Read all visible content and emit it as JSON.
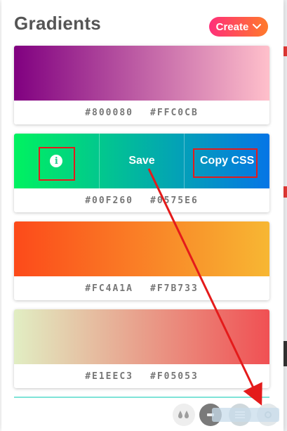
{
  "header": {
    "title": "Gradients",
    "create_label": "Create",
    "create_colors": [
      "#ff2f7a",
      "#ff7a2a"
    ]
  },
  "gradients": [
    {
      "from": "#800080",
      "to": "#FFC0CB"
    },
    {
      "from": "#00F260",
      "to": "#0575E6"
    },
    {
      "from": "#FC4A1A",
      "to": "#F7B733"
    },
    {
      "from": "#E1EEC3",
      "to": "#F05053"
    }
  ],
  "hover_actions": {
    "info_icon_glyph": "i",
    "save_label": "Save",
    "copy_label": "Copy CSS"
  },
  "colors": {
    "annotation": "#e41b1b",
    "code_text": "#777777"
  },
  "bottom_icons": [
    "water-drops-icon",
    "tool-icon",
    "menu-icon",
    "settings-icon"
  ]
}
